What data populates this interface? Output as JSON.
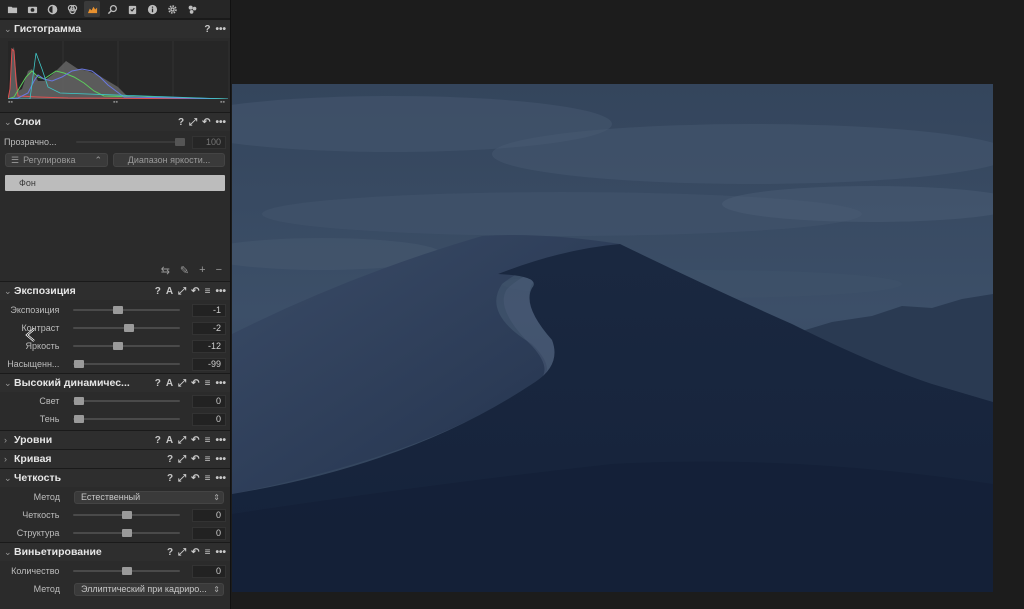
{
  "toolbar": {
    "icons": [
      "folder-icon",
      "camera-icon",
      "circle-icon",
      "color-wheel-icon",
      "exposure-tool-icon",
      "search-icon",
      "clipboard-icon",
      "info-icon",
      "gear-icon",
      "styles-icon"
    ],
    "active": "exposure-tool-icon"
  },
  "histogram": {
    "title": "Гистограмма",
    "help": "?",
    "more": "•••"
  },
  "layers": {
    "title": "Слои",
    "help": "?",
    "more": "•••",
    "opacity_label": "Прозрачно...",
    "opacity_value": "100",
    "adjust_button": "Регулировка",
    "luma_button": "Диапазон яркости...",
    "items": [
      {
        "name": "Фон"
      }
    ]
  },
  "exposure": {
    "title": "Экспозиция",
    "help": "?",
    "auto": "A",
    "more": "•••",
    "rows": [
      {
        "label": "Экспозиция",
        "value": "-1",
        "level": 0.42
      },
      {
        "label": "Контраст",
        "value": "-2",
        "level": 0.52
      },
      {
        "label": "Яркость",
        "value": "-12",
        "level": 0.42
      },
      {
        "label": "Насыщенн...",
        "value": "-99",
        "level": 0.05
      }
    ]
  },
  "hdr": {
    "title": "Высокий динамичес...",
    "help": "?",
    "auto": "A",
    "more": "•••",
    "rows": [
      {
        "label": "Свет",
        "value": "0",
        "level": 0.05
      },
      {
        "label": "Тень",
        "value": "0",
        "level": 0.05
      }
    ]
  },
  "levels": {
    "title": "Уровни",
    "help": "?",
    "auto": "A",
    "more": "•••"
  },
  "curve": {
    "title": "Кривая",
    "help": "?",
    "more": "•••"
  },
  "clarity": {
    "title": "Четкость",
    "help": "?",
    "more": "•••",
    "method_label": "Метод",
    "method_value": "Естественный",
    "rows": [
      {
        "label": "Четкость",
        "value": "0",
        "level": 0.5
      },
      {
        "label": "Структура",
        "value": "0",
        "level": 0.5
      }
    ]
  },
  "vignetting": {
    "title": "Виньетирование",
    "help": "?",
    "more": "•••",
    "rows": [
      {
        "label": "Количество",
        "value": "0",
        "level": 0.5
      }
    ],
    "method_label": "Метод",
    "method_value": "Эллиптический при кадриро..."
  },
  "colors": {
    "panel_bg": "#2b2b2b",
    "accent": "#e8912f",
    "photo_sky": "#35475f",
    "photo_dune": "#1d2a40"
  }
}
